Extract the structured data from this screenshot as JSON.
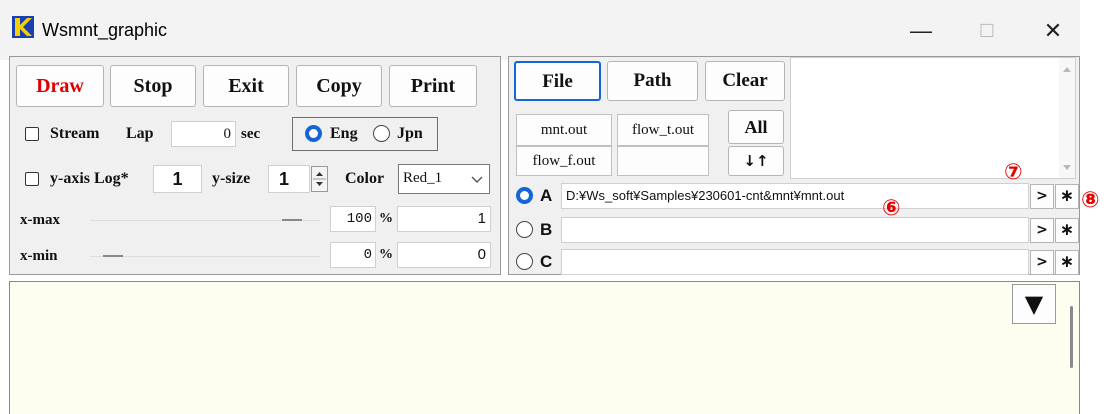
{
  "window": {
    "title": "Wsmnt_graphic",
    "minimize": "—",
    "maximize": "☐",
    "close": "✕"
  },
  "toolbar": {
    "draw": "Draw",
    "stop": "Stop",
    "exit": "Exit",
    "copy": "Copy",
    "print": "Print"
  },
  "stream": {
    "label": "Stream",
    "lap_label": "Lap",
    "lap_value": "0",
    "lap_unit": "sec"
  },
  "language": {
    "eng": "Eng",
    "jpn": "Jpn"
  },
  "yaxis": {
    "log_label": "y-axis Log*",
    "log_value": "1",
    "size_label": "y-size",
    "size_value": "1",
    "color_label": "Color",
    "color_value": "Red_1"
  },
  "xmax": {
    "label": "x-max",
    "percent": "100",
    "unit": "%",
    "value": "1"
  },
  "xmin": {
    "label": "x-min",
    "percent": "0",
    "unit": "%",
    "value": "0"
  },
  "files": {
    "file": "File",
    "path": "Path",
    "clear": "Clear",
    "all": "All",
    "sort": "↓↑",
    "names": [
      "mnt.out",
      "flow_t.out",
      "flow_f.out",
      ""
    ]
  },
  "slots": [
    {
      "label": "A",
      "path": "D:¥Ws_soft¥Samples¥230601-cnt&mnt¥mnt.out"
    },
    {
      "label": "B",
      "path": ""
    },
    {
      "label": "C",
      "path": ""
    }
  ],
  "slot_buttons": {
    "next": ">",
    "star": "∗"
  },
  "annotations": {
    "six": "⑥",
    "seven": "⑦",
    "eight": "⑧"
  },
  "output": {
    "scroll_down": "▼"
  },
  "colors": {
    "draw_red": "#e00000",
    "accent_blue": "#1565d8",
    "output_bg": "#fdfdf0",
    "annotation_red": "#e60000"
  }
}
